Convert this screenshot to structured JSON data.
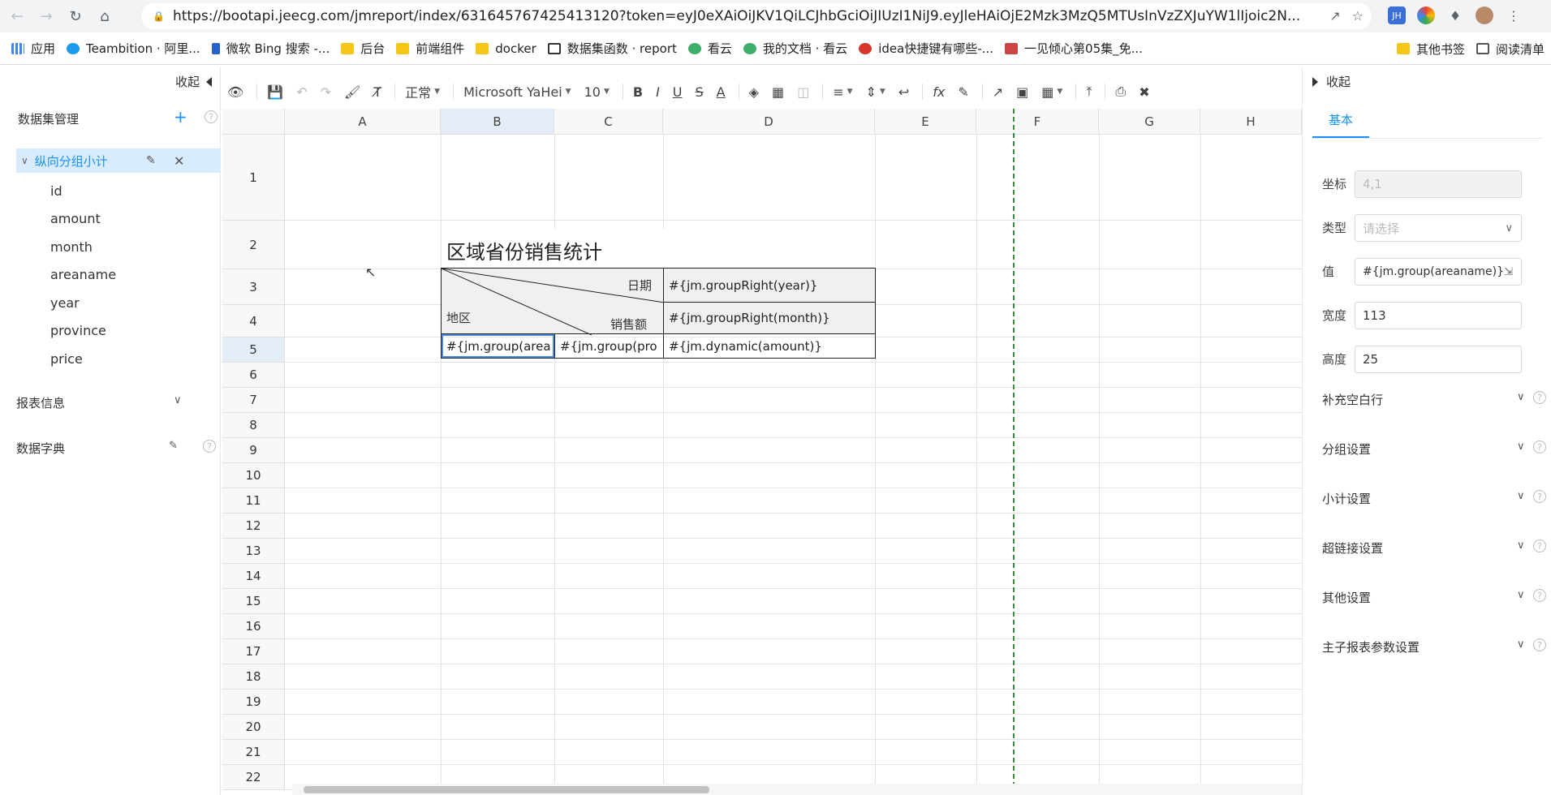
{
  "browser": {
    "url": "https://bootapi.jeecg.com/jmreport/index/631645767425413120?token=eyJ0eXAiOiJKV1QiLCJhbGciOiJIUzI1NiJ9.eyJleHAiOjE2Mzk3MzQ5MTUsInVzZXJuYW1lIjoic2N...",
    "bookmarks": [
      "应用",
      "Teambition · 阿里...",
      "微软 Bing 搜索 -...",
      "后台",
      "前端组件",
      "docker",
      "数据集函数 · report",
      "看云",
      "我的文档 · 看云",
      "idea快捷键有哪些-...",
      "一见倾心第05集_免..."
    ],
    "bookmarks_right": [
      "其他书签",
      "阅读清单"
    ],
    "ext_jh": "JH"
  },
  "left": {
    "collapse": "收起",
    "dataset_title": "数据集管理",
    "dataset_name": "纵向分组小计",
    "fields": [
      "id",
      "amount",
      "month",
      "areaname",
      "year",
      "province",
      "price"
    ],
    "report_info": "报表信息",
    "dict": "数据字典"
  },
  "toolbar": {
    "style": "正常",
    "font": "Microsoft YaHei",
    "size": "10"
  },
  "sheet": {
    "columns": [
      "A",
      "B",
      "C",
      "D",
      "E",
      "F",
      "G",
      "H"
    ],
    "rows": [
      "1",
      "2",
      "3",
      "4",
      "5",
      "6",
      "7",
      "8",
      "9",
      "10",
      "11",
      "12",
      "13",
      "14",
      "15",
      "16",
      "17",
      "18",
      "19",
      "20",
      "21",
      "22"
    ],
    "title": "区域省份销售统计",
    "diag_date": "日期",
    "diag_area": "地区",
    "diag_sales": "销售额",
    "d3": "#{jm.groupRight(year)}",
    "d4": "#{jm.groupRight(month)}",
    "b5": "#{jm.group(area",
    "c5": "#{jm.group(pro",
    "d5": "#{jm.dynamic(amount)}"
  },
  "right": {
    "collapse": "收起",
    "tab": "基本",
    "coord_label": "坐标",
    "coord_value": "4,1",
    "type_label": "类型",
    "type_placeholder": "请选择",
    "value_label": "值",
    "value_value": "#{jm.group(areaname)}",
    "width_label": "宽度",
    "width_value": "113",
    "height_label": "高度",
    "height_value": "25",
    "sections": [
      "补充空白行",
      "分组设置",
      "小计设置",
      "超链接设置",
      "其他设置",
      "主子报表参数设置"
    ]
  }
}
